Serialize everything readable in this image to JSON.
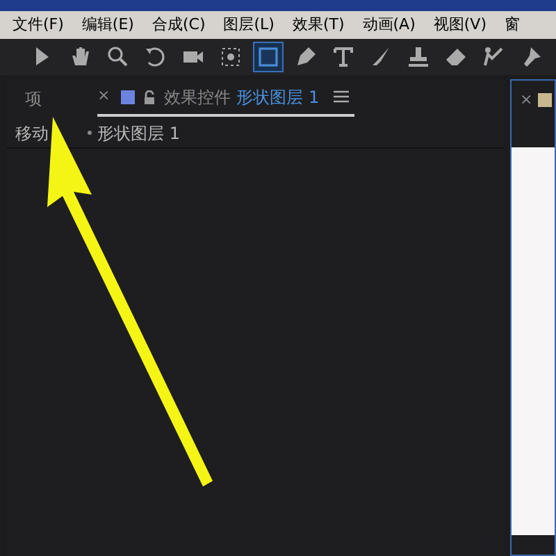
{
  "menu_bar": {
    "items": [
      "文件(F)",
      "编辑(E)",
      "合成(C)",
      "图层(L)",
      "效果(T)",
      "动画(A)",
      "视图(V)",
      "窗"
    ]
  },
  "toolbar": {
    "tools": [
      {
        "kind": "select",
        "selected": false
      },
      {
        "kind": "hand",
        "selected": false
      },
      {
        "kind": "zoom",
        "selected": false
      },
      {
        "kind": "rotate",
        "selected": false
      },
      {
        "kind": "camera",
        "selected": false
      },
      {
        "kind": "pan",
        "selected": false
      },
      {
        "kind": "rect",
        "selected": true
      },
      {
        "kind": "pen",
        "selected": false
      },
      {
        "kind": "text",
        "selected": false
      },
      {
        "kind": "brush",
        "selected": false
      },
      {
        "kind": "stamp",
        "selected": false
      },
      {
        "kind": "eraser",
        "selected": false
      },
      {
        "kind": "roto",
        "selected": false
      },
      {
        "kind": "pin",
        "selected": false
      }
    ]
  },
  "left_panel": {
    "tabs": [
      {
        "label": "项",
        "selected": false
      }
    ],
    "effects_tab": {
      "close": "×",
      "label": "效果控件",
      "layer": "形状图层 1",
      "selected": true
    },
    "breadcrumb": {
      "comp": "移动",
      "layer": "形状图层 1"
    }
  },
  "right_panel": {
    "close": "×"
  }
}
